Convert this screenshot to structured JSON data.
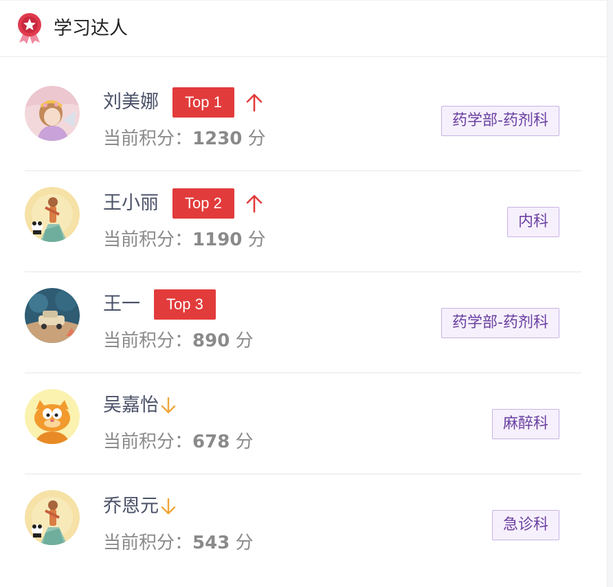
{
  "header": {
    "title": "学习达人",
    "icon": "award-ribbon-icon"
  },
  "score_label": "当前积分：",
  "score_unit": "分",
  "colors": {
    "top_badge": "#e23b3b",
    "arrow_up": "#e23b3b",
    "arrow_down": "#f0a63a",
    "dept_border": "#c7b1e4",
    "dept_text": "#6a3fa0"
  },
  "users": [
    {
      "name": "刘美娜",
      "badge": "Top 1",
      "trend": "up",
      "score": "1230",
      "dept": "药学部-药剂科",
      "avatar": "girl-flower-avatar"
    },
    {
      "name": "王小丽",
      "badge": "Top 2",
      "trend": "up",
      "score": "1190",
      "dept": "内科",
      "avatar": "girl-panda-avatar"
    },
    {
      "name": "王一",
      "badge": "Top 3",
      "trend": "none",
      "score": "890",
      "dept": "药学部-药剂科",
      "avatar": "landscape-car-avatar"
    },
    {
      "name": "吴嘉怡",
      "badge": "",
      "trend": "down",
      "score": "678",
      "dept": "麻醉科",
      "avatar": "garfield-avatar"
    },
    {
      "name": "乔恩元",
      "badge": "",
      "trend": "down",
      "score": "543",
      "dept": "急诊科",
      "avatar": "girl-panda-avatar"
    }
  ]
}
